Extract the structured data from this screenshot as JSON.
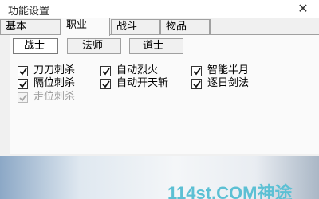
{
  "window": {
    "title": "功能设置",
    "close_label": "✕"
  },
  "main_tabs": [
    {
      "label": "基本",
      "active": false
    },
    {
      "label": "职业",
      "active": true
    },
    {
      "label": "战斗",
      "active": false
    },
    {
      "label": "物品",
      "active": false
    },
    {
      "label": "",
      "active": false
    }
  ],
  "sub_tabs": [
    {
      "label": "战士",
      "active": true
    },
    {
      "label": "法师",
      "active": false
    },
    {
      "label": "道士",
      "active": false
    }
  ],
  "options": [
    {
      "label": "刀刀刺杀",
      "checked": true,
      "enabled": true
    },
    {
      "label": "自动烈火",
      "checked": true,
      "enabled": true
    },
    {
      "label": "智能半月",
      "checked": true,
      "enabled": true
    },
    {
      "label": "隔位刺杀",
      "checked": true,
      "enabled": true
    },
    {
      "label": "自动开天斩",
      "checked": true,
      "enabled": true
    },
    {
      "label": "逐日剑法",
      "checked": true,
      "enabled": true
    },
    {
      "label": "走位刺杀",
      "checked": true,
      "enabled": false
    }
  ],
  "watermark": "114st.COM神途",
  "colors": {
    "watermark": "#5cc0d4",
    "disabled_text": "#a0a0a0"
  }
}
